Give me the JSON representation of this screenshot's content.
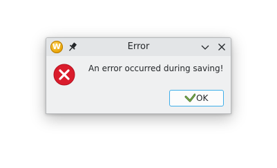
{
  "window": {
    "title": "Error",
    "app_icon": "wolfram-w-icon",
    "app_icon_letter": "W"
  },
  "message": {
    "text": "An error occurred during saving!",
    "icon": "error-icon"
  },
  "buttons": {
    "ok_label": "OK"
  },
  "colors": {
    "error_red": "#da1c2c",
    "focus_border": "#3daee9",
    "dialog_bg": "#eff0f1",
    "titlebar_bg": "#e3e5e7"
  }
}
